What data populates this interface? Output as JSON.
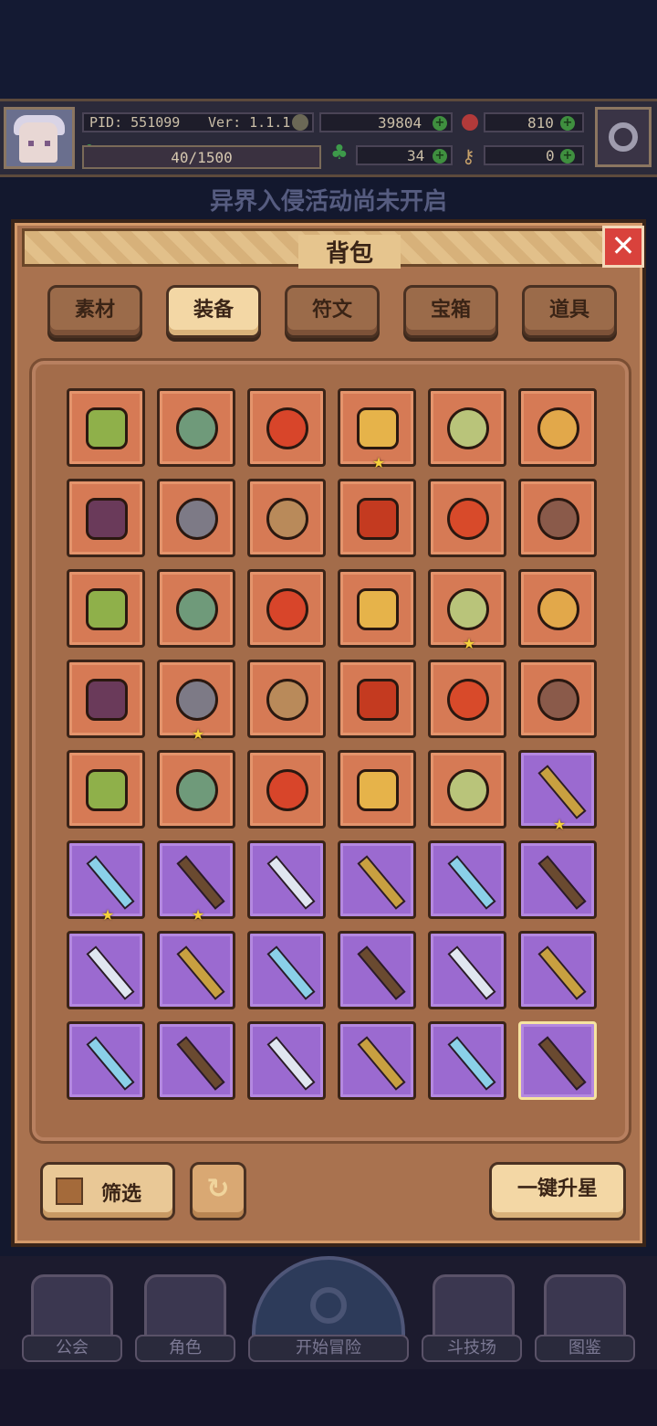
{
  "status": {
    "pid": "PID: 551099",
    "version": "Ver: 1.1.1.0",
    "gold": "39804",
    "gems": "810",
    "exp": "40/1500",
    "clover": "34",
    "keys": "0"
  },
  "banner": "异界入侵活动尚未开启",
  "bag": {
    "title": "背包",
    "close_icon": "close-icon",
    "tabs": [
      "素材",
      "装备",
      "符文",
      "宝箱",
      "道具"
    ],
    "active_tab": "装备",
    "filter_label": "筛选",
    "upstar_label": "一键升星",
    "items": [
      {
        "name": "green-armor-icon",
        "rarity": "orange",
        "star": false
      },
      {
        "name": "jade-armor-icon",
        "rarity": "orange",
        "star": false
      },
      {
        "name": "flame-armor-icon",
        "rarity": "orange",
        "star": false
      },
      {
        "name": "gold-bone-icon",
        "rarity": "orange",
        "star": true
      },
      {
        "name": "green-glove-icon",
        "rarity": "orange",
        "star": false
      },
      {
        "name": "gold-glove-icon",
        "rarity": "orange",
        "star": false
      },
      {
        "name": "dark-belt-icon",
        "rarity": "orange",
        "star": false
      },
      {
        "name": "iron-belt-icon",
        "rarity": "orange",
        "star": false
      },
      {
        "name": "leather-belt-icon",
        "rarity": "orange",
        "star": false
      },
      {
        "name": "fire-belt-icon",
        "rarity": "orange",
        "star": false
      },
      {
        "name": "flame-cape-icon",
        "rarity": "orange",
        "star": false
      },
      {
        "name": "winged-belt-icon",
        "rarity": "orange",
        "star": false
      },
      {
        "name": "green-boots-icon",
        "rarity": "orange",
        "star": false
      },
      {
        "name": "leather-boots-icon",
        "rarity": "orange",
        "star": false
      },
      {
        "name": "ice-boots-icon",
        "rarity": "orange",
        "star": false
      },
      {
        "name": "fire-boots-icon",
        "rarity": "orange",
        "star": false
      },
      {
        "name": "gem-amulet-icon",
        "rarity": "orange",
        "star": true
      },
      {
        "name": "fire-gem-icon",
        "rarity": "orange",
        "star": false
      },
      {
        "name": "green-star-icon",
        "rarity": "orange",
        "star": false
      },
      {
        "name": "green-heart-necklace-icon",
        "rarity": "orange",
        "star": true
      },
      {
        "name": "fire-heart-necklace-icon",
        "rarity": "orange",
        "star": false
      },
      {
        "name": "gold-necklace-icon",
        "rarity": "orange",
        "star": false
      },
      {
        "name": "ruby-ring-icon",
        "rarity": "orange",
        "star": false
      },
      {
        "name": "charm-necklace-icon",
        "rarity": "orange",
        "star": false
      },
      {
        "name": "feather-necklace-icon",
        "rarity": "orange",
        "star": false
      },
      {
        "name": "lava-ring-icon",
        "rarity": "orange",
        "star": false
      },
      {
        "name": "angel-ring-icon",
        "rarity": "orange",
        "star": false
      },
      {
        "name": "gem-ring-icon",
        "rarity": "orange",
        "star": false
      },
      {
        "name": "dark-ring-icon",
        "rarity": "orange",
        "star": false
      },
      {
        "name": "pistol-icon",
        "rarity": "purple",
        "star": true
      },
      {
        "name": "fire-staff-icon",
        "rarity": "purple",
        "star": true
      },
      {
        "name": "green-staff-icon",
        "rarity": "purple",
        "star": true
      },
      {
        "name": "ice-wand-icon",
        "rarity": "purple",
        "star": false
      },
      {
        "name": "feather-wand-icon",
        "rarity": "purple",
        "star": false
      },
      {
        "name": "gold-sword-icon",
        "rarity": "purple",
        "star": false
      },
      {
        "name": "bow-icon",
        "rarity": "purple",
        "star": false
      },
      {
        "name": "ice-sword-icon",
        "rarity": "purple",
        "star": false
      },
      {
        "name": "crystal-staff-icon",
        "rarity": "purple",
        "star": false
      },
      {
        "name": "bronze-blade-icon",
        "rarity": "purple",
        "star": false
      },
      {
        "name": "dark-blade-icon",
        "rarity": "purple",
        "star": false
      },
      {
        "name": "steel-sword-icon",
        "rarity": "purple",
        "star": false
      },
      {
        "name": "spear-icon",
        "rarity": "purple",
        "star": false
      },
      {
        "name": "serrated-blade-icon",
        "rarity": "purple",
        "star": false
      },
      {
        "name": "silver-sword-icon",
        "rarity": "purple",
        "star": false
      },
      {
        "name": "broad-sword-icon",
        "rarity": "purple",
        "star": false
      },
      {
        "name": "horn-icon",
        "rarity": "purple",
        "star": false
      },
      {
        "name": "rapier-icon",
        "rarity": "purple",
        "star": false
      },
      {
        "name": "crossbow-icon",
        "rarity": "purple",
        "star": false,
        "selected": true
      }
    ]
  },
  "nav": {
    "items": [
      {
        "label": "公会",
        "icon": "guild-icon"
      },
      {
        "label": "角色",
        "icon": "character-icon"
      },
      {
        "label": "开始冒险",
        "icon": "adventure-icon"
      },
      {
        "label": "斗技场",
        "icon": "arena-icon"
      },
      {
        "label": "图鉴",
        "icon": "codex-icon"
      }
    ]
  },
  "colors": {
    "orange_slot": "#d67a55",
    "purple_slot": "#9b6ad0",
    "panel": "#a9724f",
    "star": "#f6d23a"
  }
}
